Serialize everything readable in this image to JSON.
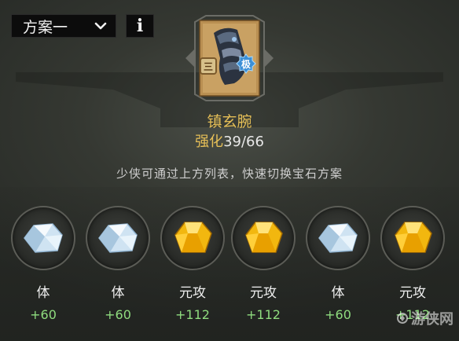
{
  "plan_dropdown": {
    "selected": "方案一"
  },
  "info_button": {
    "label": "i"
  },
  "item": {
    "name": "镇玄腕",
    "tier_badge": "三",
    "grade_badge": "极",
    "upgrade_label": "强化",
    "upgrade_value": "39/66"
  },
  "hint": "少侠可通过上方列表，快速切换宝石方案",
  "gems": [
    {
      "type": "white-crystal",
      "stat": "体",
      "value": "+60"
    },
    {
      "type": "white-crystal",
      "stat": "体",
      "value": "+60"
    },
    {
      "type": "gold-crystal",
      "stat": "元攻",
      "value": "+112"
    },
    {
      "type": "gold-crystal",
      "stat": "元攻",
      "value": "+112"
    },
    {
      "type": "white-crystal",
      "stat": "体",
      "value": "+60"
    },
    {
      "type": "gold-crystal",
      "stat": "元攻",
      "value": "+112"
    }
  ],
  "watermark": "游侠网",
  "colors": {
    "gold_text": "#e6bf57",
    "green_value": "#8fdc7e",
    "panel_bg": "#2e312c"
  }
}
